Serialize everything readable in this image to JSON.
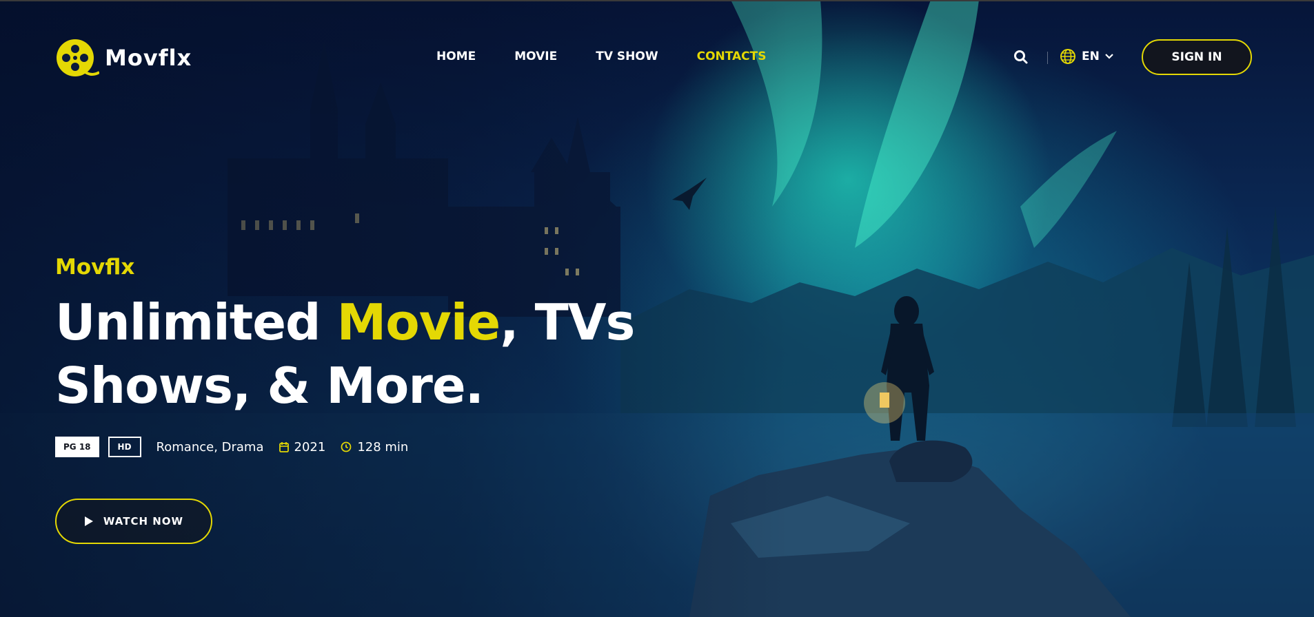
{
  "header": {
    "logo_text": "Movflx",
    "nav": [
      {
        "label": "HOME",
        "active": false
      },
      {
        "label": "MOVIE",
        "active": false
      },
      {
        "label": "TV SHOW",
        "active": false
      },
      {
        "label": "CONTACTS",
        "active": true
      }
    ],
    "search_icon": "search-icon",
    "language": {
      "icon": "globe-icon",
      "label": "EN",
      "caret": "chevron-down-icon"
    },
    "sign_in_label": "SIGN IN"
  },
  "hero": {
    "subtitle": "Movflx",
    "headline_part1": "Unlimited ",
    "headline_highlight": "Movie",
    "headline_part2": ", TVs",
    "headline_line2": "Shows, & More.",
    "badge_rating": "PG 18",
    "badge_quality": "HD",
    "genres": "Romance, Drama",
    "year": "2021",
    "duration": "128 min",
    "watch_label": "WATCH NOW"
  },
  "colors": {
    "accent": "#e4d804",
    "dark": "#12151e",
    "text": "#ffffff"
  }
}
